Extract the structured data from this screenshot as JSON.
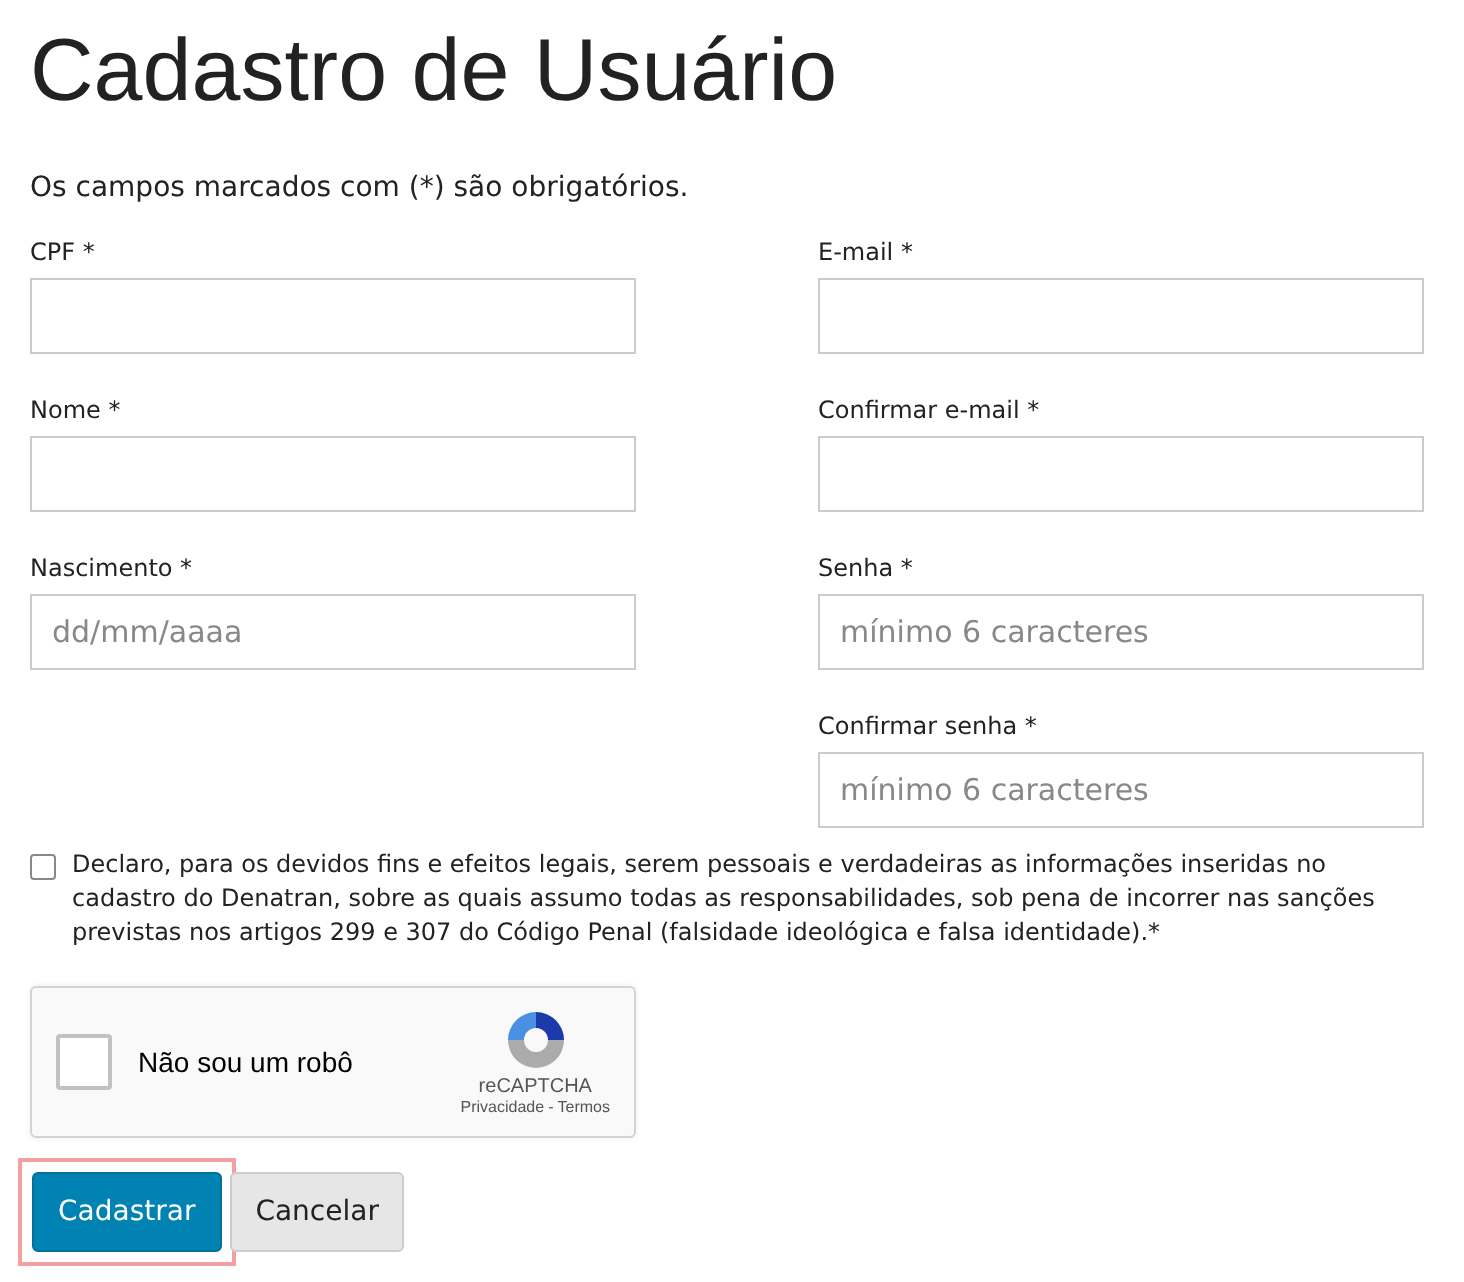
{
  "title": "Cadastro de Usuário",
  "note": "Os campos marcados com (*) são obrigatórios.",
  "columns": [
    {
      "fields": [
        {
          "label": "CPF *"
        },
        {
          "label": "Nome *"
        },
        {
          "label": "Nascimento *",
          "placeholder": "dd/mm/aaaa"
        }
      ]
    },
    {
      "fields": [
        {
          "label": "E-mail *"
        },
        {
          "label": "Confirmar e-mail *"
        },
        {
          "label": "Senha *",
          "placeholder": "mínimo 6 caracteres"
        },
        {
          "label": "Confirmar senha *",
          "placeholder": "mínimo 6 caracteres"
        }
      ]
    }
  ],
  "declaration": {
    "checked": false,
    "text": "Declaro, para os devidos fins e efeitos legais, serem pessoais e verdadeiras as informações inseridas no cadastro do Denatran, sobre as quais assumo todas as responsabilidades, sob pena de incorrer nas sanções previstas nos artigos 299 e 307 do Código Penal (falsidade ideológica e falsa identidade).*"
  },
  "captcha": {
    "checked": false,
    "label": "Não sou um robô",
    "brand": "reCAPTCHA",
    "links": [
      "Privacidade",
      "Termos"
    ],
    "separator": "-"
  },
  "buttons": [
    {
      "label": "Cadastrar",
      "kind": "primary",
      "focused": true
    },
    {
      "label": "Cancelar",
      "kind": "secondary",
      "focused": false
    }
  ]
}
